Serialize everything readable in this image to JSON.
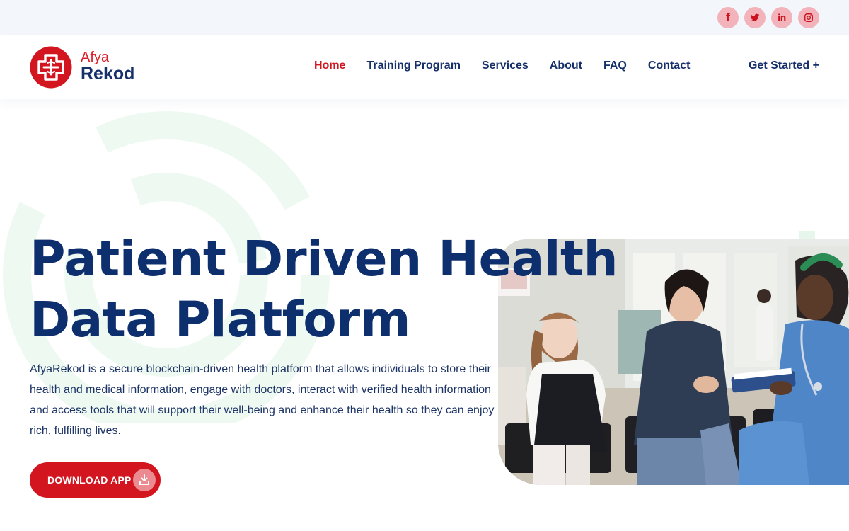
{
  "social": [
    {
      "name": "facebook-icon"
    },
    {
      "name": "twitter-icon"
    },
    {
      "name": "linkedin-icon"
    },
    {
      "name": "instagram-icon"
    }
  ],
  "logo": {
    "line1": "Afya",
    "line2": "Rekod"
  },
  "nav": {
    "items": [
      {
        "label": "Home",
        "active": true
      },
      {
        "label": "Training Program"
      },
      {
        "label": "Services"
      },
      {
        "label": "About"
      },
      {
        "label": "FAQ"
      },
      {
        "label": "Contact"
      }
    ],
    "cta": "Get Started +"
  },
  "hero": {
    "title_line1": "Patient Driven Health",
    "title_line2": "Data Platform",
    "description": "AfyaRekod is a secure blockchain-driven health platform that allows individuals to store their health and medical information, engage with doctors, interact with verified health information and access tools that will support their well-being and enhance their health so they can enjoy rich, fulfilling lives.",
    "download_label": "DOWNLOAD APP"
  },
  "colors": {
    "brand_red": "#d2151f",
    "brand_navy": "#0d2f6e",
    "topbar_bg": "#f3f7fb",
    "social_bg": "#f2b3bb"
  },
  "icons": {
    "download": "download-icon",
    "logo": "medical-cross-logo"
  }
}
